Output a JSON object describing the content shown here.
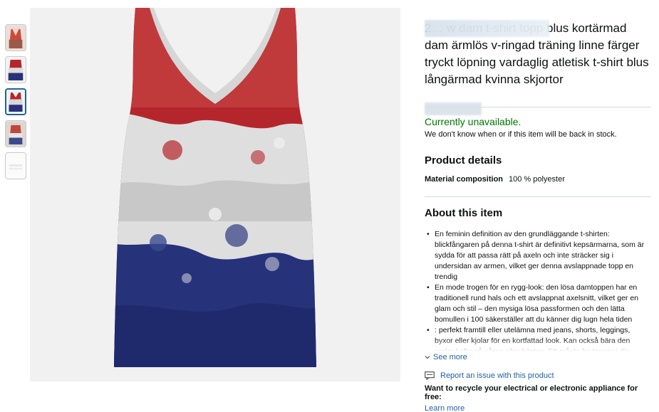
{
  "thumbnails": [
    {
      "name": "thumb-1",
      "selected": false
    },
    {
      "name": "thumb-2",
      "selected": false
    },
    {
      "name": "thumb-3",
      "selected": true
    },
    {
      "name": "thumb-4",
      "selected": false
    },
    {
      "name": "thumb-5",
      "selected": false
    }
  ],
  "product": {
    "title": "2… w dam t-shirt topp blus kortärmad dam ärmlös v-ringad träning linne färger tryckt löpning vardaglig atletisk t-shirt blus långärmad kvinna skjortor"
  },
  "availability": {
    "status": "Currently unavailable.",
    "note": "We don't know when or if this item will be back in stock."
  },
  "details": {
    "heading": "Product details",
    "rows": [
      {
        "key": "Material composition",
        "value": "100 % polyester"
      }
    ]
  },
  "about": {
    "heading": "About this item",
    "bullets": [
      "En feminin definition av den grundläggande t-shirten: blickfångaren på denna t-shirt är definitivt kepsärmarna, som är sydda för att passa rätt på axeln och inte sträcker sig i undersidan av armen, vilket ger denna avslappnade topp en trendig",
      "En mode trogen för en rygg-look: den lösa damtoppen har en traditionell rund hals och ett avslappnat axelsnitt, vilket ger en glam och stil – den mysiga lösa passformen och den lätta bomullen i 100 säkerställer att du känner dig lugn hela tiden",
      ": perfekt framtill eller utelämna med jeans, shorts, leggings, byxor eller kjolar för en kortfattad look. Kan också bära den under kofta på våren eller hösten. Ett måste-ha toppar i din garderob"
    ],
    "see_more": "See more"
  },
  "footer": {
    "report": "Report an issue with this product",
    "recycle": "Want to recycle your electrical or electronic appliance for free:",
    "learn_more": "Learn more"
  },
  "colors": {
    "link": "#2162a1",
    "available": "#007600",
    "red": "#b5262c",
    "white": "#e8e8e8",
    "blue": "#26327a"
  },
  "icons": [
    "share-icon",
    "chevron-down-icon",
    "report-icon"
  ]
}
